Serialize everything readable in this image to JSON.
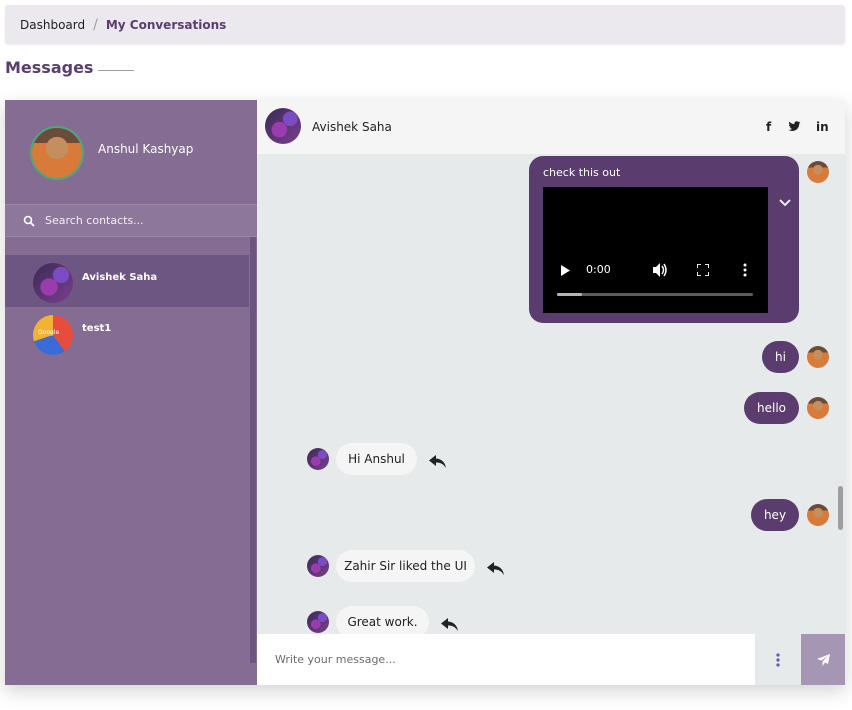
{
  "breadcrumb": {
    "home": "Dashboard",
    "separator": "/",
    "current": "My Conversations"
  },
  "page": {
    "title": "Messages"
  },
  "profile": {
    "name": "Anshul Kashyap"
  },
  "search": {
    "placeholder": "Search contacts..."
  },
  "contacts": [
    {
      "name": "Avishek Saha",
      "active": true
    },
    {
      "name": "test1",
      "avatar_text": "Google",
      "active": false
    }
  ],
  "chat": {
    "contact_name": "Avishek Saha",
    "social": {
      "facebook": "f",
      "twitter": "twitter",
      "linkedin": "in"
    },
    "video_message": {
      "caption": "check this out",
      "time": "0:00",
      "progress": 0.13
    },
    "messages": [
      {
        "dir": "out",
        "text": "hi"
      },
      {
        "dir": "out",
        "text": "hello"
      },
      {
        "dir": "in",
        "text": "Hi Anshul"
      },
      {
        "dir": "out",
        "text": "hey"
      },
      {
        "dir": "in",
        "text": "Zahir Sir liked the UI"
      },
      {
        "dir": "in",
        "text": "Great work."
      }
    ]
  },
  "composer": {
    "placeholder": "Write your message..."
  },
  "colors": {
    "accent": "#5b3c6f",
    "sidebar": "#846c93",
    "chat_bg": "#e6eaeb",
    "send_button": "#a597b3"
  },
  "icons": {
    "search": "search-icon",
    "send": "send-icon",
    "more": "kebab-icon",
    "reply": "reply-icon",
    "chevron": "chevron-down-icon"
  }
}
